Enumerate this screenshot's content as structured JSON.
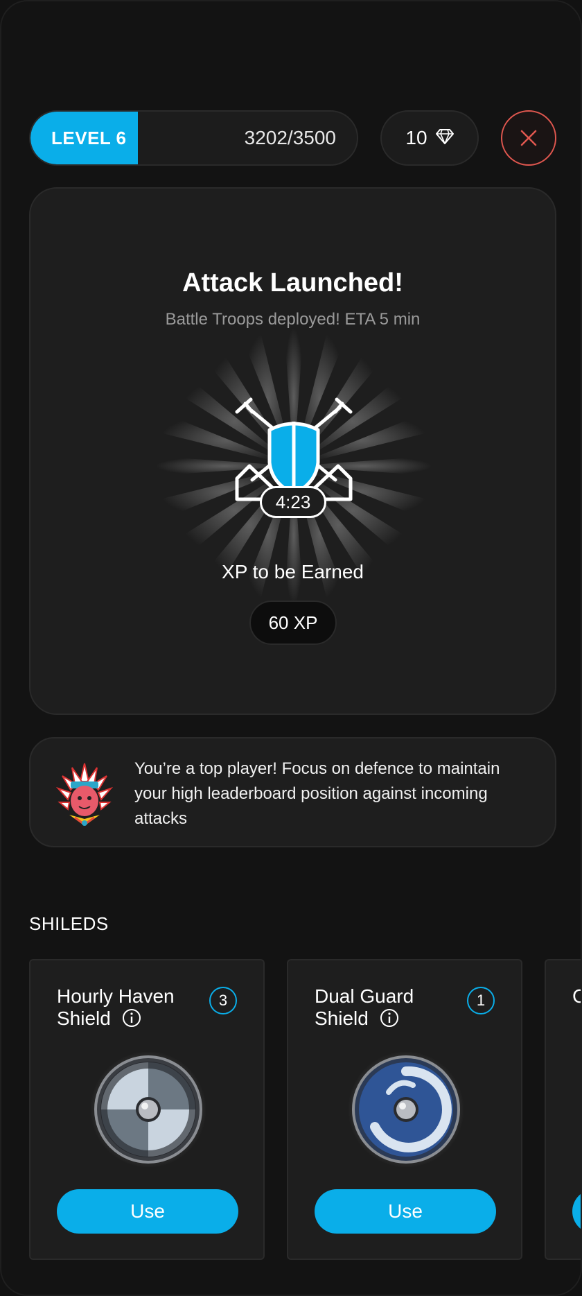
{
  "header": {
    "level_label": "LEVEL 6",
    "xp_current": 3202,
    "xp_max": 3500,
    "xp_text": "3202/3500",
    "gems": "10",
    "gem_icon": "diamond-icon",
    "close_icon": "close-icon"
  },
  "attack": {
    "title": "Attack Launched!",
    "subtitle": "Battle Troops deployed! ETA 5 min",
    "timer": "4:23",
    "xp_label": "XP to be Earned",
    "xp_value": "60 XP"
  },
  "tip": {
    "text": "You’re a top player! Focus on defence to maintain your high leaderboard position against incoming attacks"
  },
  "shields_section": {
    "title": "SHILEDS",
    "items": [
      {
        "name": "Hourly Haven Shield",
        "count": "3",
        "button": "Use"
      },
      {
        "name": "Dual Guard Shield",
        "count": "1",
        "button": "Use"
      },
      {
        "name": "C S",
        "count": "",
        "button": ""
      }
    ]
  },
  "colors": {
    "accent": "#0aaee9",
    "danger": "#e0574f",
    "background": "#131313",
    "card": "#1e1e1e"
  }
}
